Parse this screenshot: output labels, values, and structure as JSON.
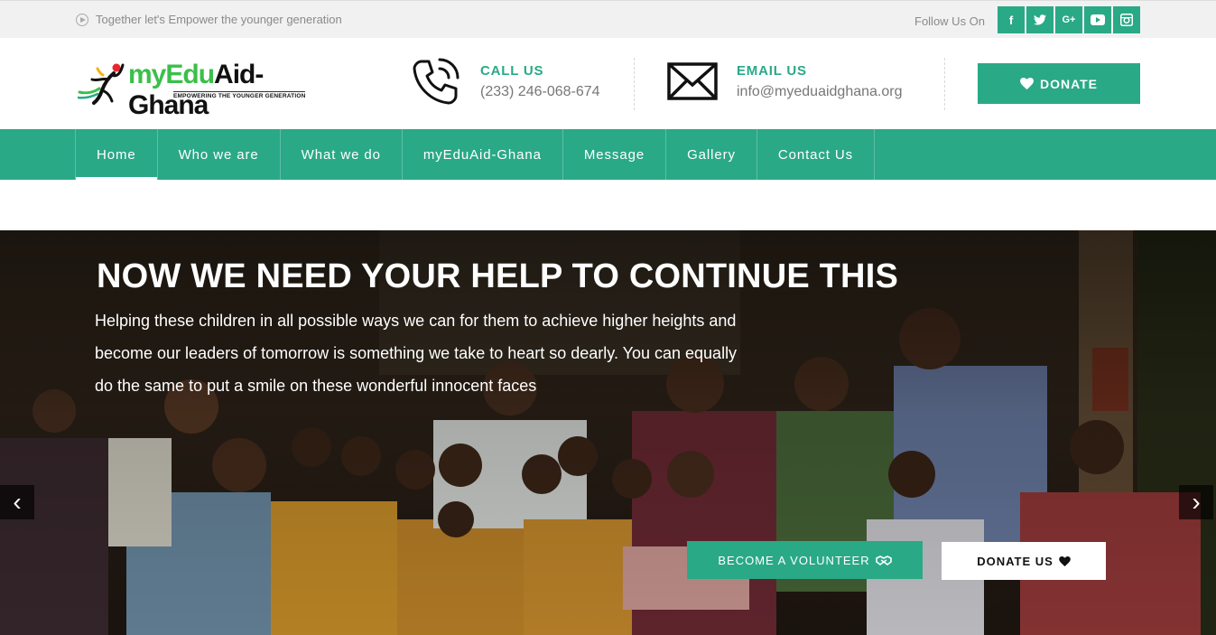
{
  "topbar": {
    "tagline": "Together let's Empower the younger generation",
    "follow_label": "Follow Us On",
    "socials": [
      {
        "icon": "facebook-icon",
        "glyph": "f"
      },
      {
        "icon": "twitter-icon",
        "glyph": "t"
      },
      {
        "icon": "google-plus-icon",
        "glyph": "G+"
      },
      {
        "icon": "youtube-icon",
        "glyph": "▶"
      },
      {
        "icon": "instagram-icon",
        "glyph": "◙"
      }
    ]
  },
  "header": {
    "logo": {
      "part1": "myEdu",
      "part2": "Aid-Ghana",
      "subtitle": "EMPOWERING THE YOUNGER GENERATION"
    },
    "call": {
      "label": "CALL US",
      "value": "(233) 246-068-674"
    },
    "email": {
      "label": "EMAIL US",
      "value": "info@myeduaidghana.org"
    },
    "donate_label": "DONATE"
  },
  "nav": {
    "items": [
      "Home",
      "Who we are",
      "What we do",
      "myEduAid-Ghana",
      "Message",
      "Gallery",
      "Contact Us"
    ],
    "active": "Home"
  },
  "hero": {
    "title": "NOW WE NEED YOUR HELP TO CONTINUE THIS",
    "text": "Helping these children in all possible ways we can for them to achieve higher heights and become our leaders of tomorrow is something we take to heart so dearly. You can equally do the same to put a smile on these wonderful innocent faces",
    "volunteer_label": "BECOME A VOLUNTEER",
    "donate_label": "DONATE US",
    "prev_glyph": "‹",
    "next_glyph": "›"
  },
  "colors": {
    "accent": "#2aa987",
    "topbar": "#f1f1f1"
  }
}
